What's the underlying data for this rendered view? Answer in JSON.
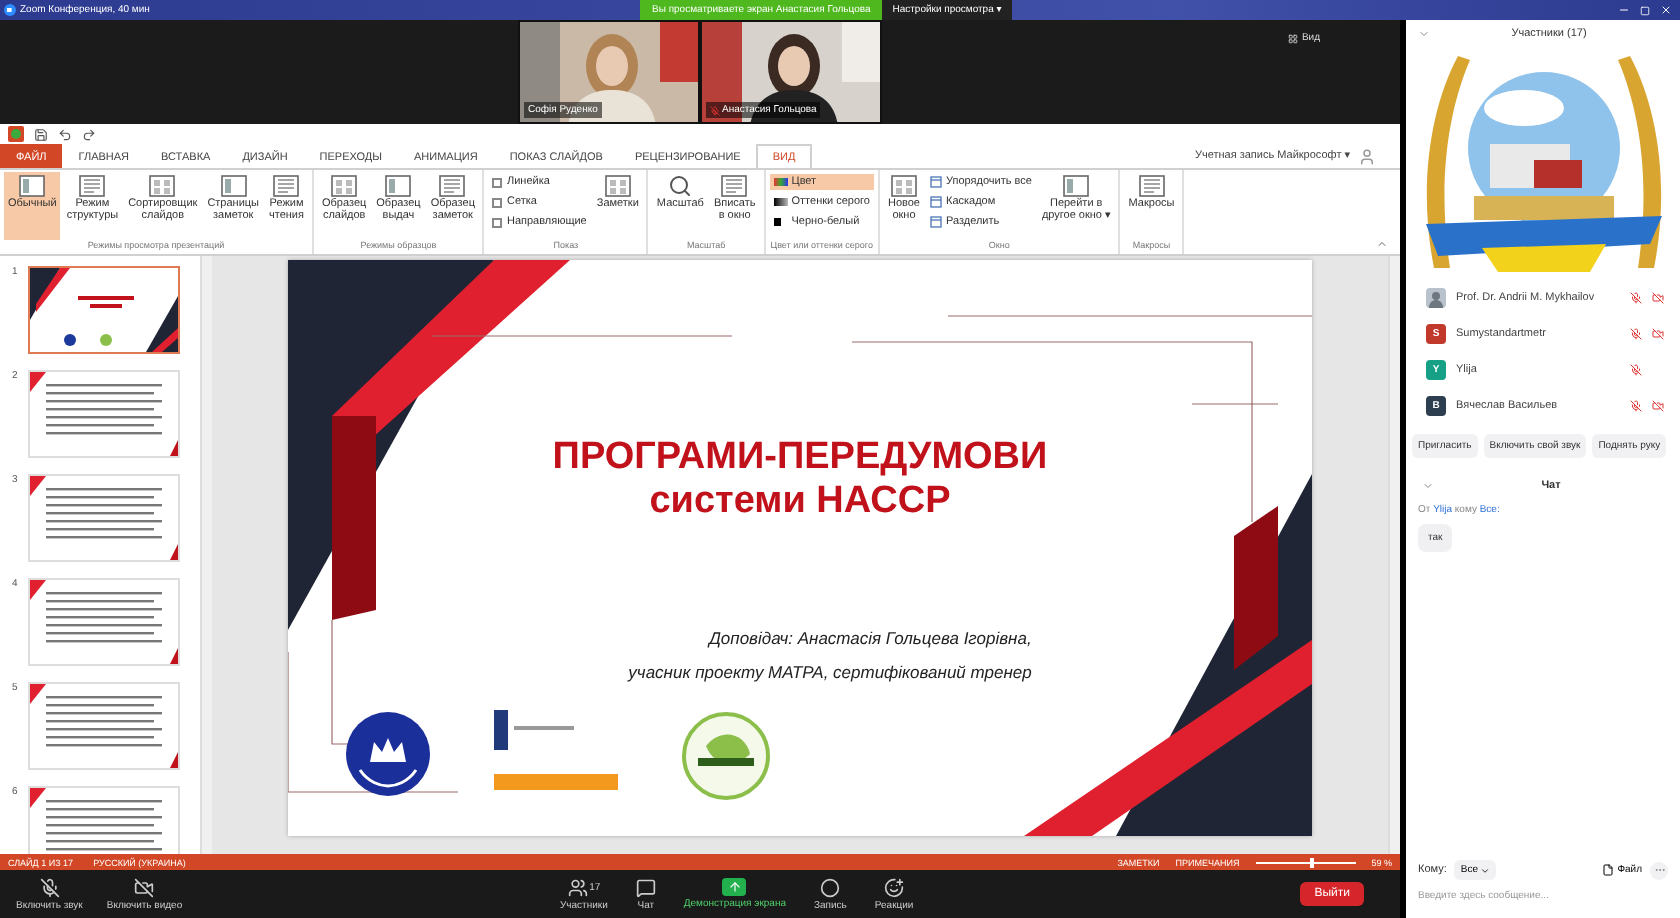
{
  "titlebar": {
    "title": "Zoom Конференция, 40 мин",
    "banner": "Вы просматриваете экран Анастасия Гольцова",
    "view_options": "Настройки просмотра ▾"
  },
  "video": {
    "tiles": [
      {
        "name": "Софія Руденко",
        "muted": false
      },
      {
        "name": "Анастасия Гольцова",
        "muted": true
      }
    ],
    "view_button": "Вид"
  },
  "powerpoint": {
    "tabs": [
      {
        "kind": "file",
        "label": "ФАЙЛ",
        "selected": false
      },
      {
        "kind": "tab",
        "label": "ГЛАВНАЯ",
        "selected": false
      },
      {
        "kind": "tab",
        "label": "ВСТАВКА",
        "selected": false
      },
      {
        "kind": "tab",
        "label": "ДИЗАЙН",
        "selected": false
      },
      {
        "kind": "tab",
        "label": "ПЕРЕХОДЫ",
        "selected": false
      },
      {
        "kind": "tab",
        "label": "АНИМАЦИЯ",
        "selected": false
      },
      {
        "kind": "tab",
        "label": "ПОКАЗ СЛАЙДОВ",
        "selected": false
      },
      {
        "kind": "tab",
        "label": "РЕЦЕНЗИРОВАНИЕ",
        "selected": false
      },
      {
        "kind": "tab",
        "label": "ВИД",
        "selected": true
      }
    ],
    "account": "Учетная запись Майкрософт ▾",
    "ribbon": [
      {
        "label": "Режимы просмотра презентаций",
        "items": [
          {
            "kind": "large",
            "label": "Обычный",
            "selected": true
          },
          {
            "kind": "large",
            "label": "Режим\nструктуры",
            "selected": false
          },
          {
            "kind": "large",
            "label": "Сортировщик\nслайдов",
            "selected": false
          },
          {
            "kind": "large",
            "label": "Страницы\nзаметок",
            "selected": false
          },
          {
            "kind": "large",
            "label": "Режим\nчтения",
            "selected": false
          }
        ]
      },
      {
        "label": "Режимы образцов",
        "items": [
          {
            "kind": "large",
            "label": "Образец\nслайдов",
            "selected": false
          },
          {
            "kind": "large",
            "label": "Образец\nвыдач",
            "selected": false
          },
          {
            "kind": "large",
            "label": "Образец\nзаметок",
            "selected": false
          }
        ]
      },
      {
        "label": "Показ",
        "items": [
          {
            "kind": "check",
            "label": "Линейка",
            "checked": false
          },
          {
            "kind": "check",
            "label": "Сетка",
            "checked": false
          },
          {
            "kind": "check",
            "label": "Направляющие",
            "checked": false
          },
          {
            "kind": "large",
            "label": "Заметки",
            "selected": false
          }
        ]
      },
      {
        "label": "Масштаб",
        "items": [
          {
            "kind": "large",
            "label": "Масштаб",
            "selected": false
          },
          {
            "kind": "large",
            "label": "Вписать\nв окно",
            "selected": false
          }
        ]
      },
      {
        "label": "Цвет или оттенки серого",
        "items": [
          {
            "kind": "color",
            "label": "Цвет",
            "selected": true
          },
          {
            "kind": "color",
            "label": "Оттенки серого",
            "selected": false
          },
          {
            "kind": "color",
            "label": "Черно-белый",
            "selected": false
          }
        ]
      },
      {
        "label": "Окно",
        "items": [
          {
            "kind": "large",
            "label": "Новое\nокно",
            "selected": false
          },
          {
            "kind": "small",
            "label": "Упорядочить все"
          },
          {
            "kind": "small",
            "label": "Каскадом"
          },
          {
            "kind": "small",
            "label": "Разделить"
          },
          {
            "kind": "large",
            "label": "Перейти в\nдругое окно ▾",
            "selected": false
          }
        ]
      },
      {
        "label": "Макросы",
        "items": [
          {
            "kind": "large",
            "label": "Макросы",
            "selected": false
          }
        ]
      }
    ],
    "slides": [
      {
        "number": "1",
        "selected": true
      },
      {
        "number": "2",
        "selected": false
      },
      {
        "number": "3",
        "selected": false
      },
      {
        "number": "4",
        "selected": false
      },
      {
        "number": "5",
        "selected": false
      },
      {
        "number": "6",
        "selected": false
      }
    ],
    "slide": {
      "title": [
        "ПРОГРАМИ-ПЕРЕДУМОВИ",
        "системи НАССР"
      ],
      "speaker": [
        "Доповідач: Анастасія Гольцева Ігорівна,",
        "учасник проекту МАТРА, сертифікований тренер"
      ]
    },
    "status": {
      "slide_counter": "СЛАЙД 1 ИЗ 17",
      "language": "РУССКИЙ (УКРАИНА)",
      "notes": "ЗАМЕТКИ",
      "comments": "ПРИМЕЧАНИЯ",
      "zoom": {
        "level": 0.55,
        "reading": "59 %"
      }
    }
  },
  "toolbar": {
    "buttons": [
      {
        "kind": "mic",
        "label": "Включить звук"
      },
      {
        "kind": "video",
        "label": "Включить видео"
      },
      {
        "kind": "participants",
        "label": "Участники",
        "count": "17"
      },
      {
        "kind": "chat",
        "label": "Чат"
      },
      {
        "kind": "share",
        "label": "Демонстрация экрана"
      },
      {
        "kind": "record",
        "label": "Запись"
      },
      {
        "kind": "reactions",
        "label": "Реакции"
      }
    ],
    "leave": "Выйти"
  },
  "participants": {
    "title": "Участники (17)",
    "people": [
      {
        "name": "Prof. Dr. Andrii M. Mykhailov",
        "mic_muted": true,
        "video_off": true
      },
      {
        "name": "Sumystandartmetr",
        "avatar": {
          "kind": "letter",
          "letter": "S",
          "color": "#c0392b"
        },
        "mic_muted": true,
        "video_off": true
      },
      {
        "name": "Ylija",
        "avatar": {
          "kind": "letter",
          "letter": "Y",
          "color": "#16a085"
        },
        "mic_muted": true,
        "video_off": false
      },
      {
        "name": "Вячеслав Васильев",
        "avatar": {
          "kind": "letter",
          "letter": "B",
          "color": "#2c3e50"
        },
        "mic_muted": true,
        "video_off": true
      }
    ],
    "actions": [
      "Пригласить",
      "Включить свой звук",
      "Поднять руку"
    ]
  },
  "chat": {
    "title": "Чат",
    "messages": [
      {
        "from_prefix": "От",
        "sender": "Ylija",
        "to_prefix": "кому",
        "recipient": "Все:",
        "text": "так"
      }
    ],
    "to_label": "Кому:",
    "recipient": "Все",
    "file_button": "Файл",
    "placeholder": "Введите здесь сообщение..."
  }
}
